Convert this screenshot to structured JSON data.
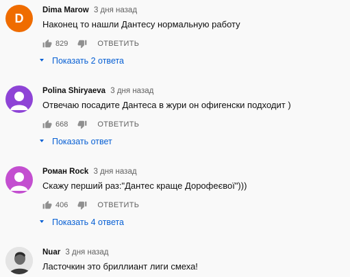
{
  "comments": [
    {
      "avatar_letter": "D",
      "avatar_color": "#ef6c00",
      "author": "Dima Marow",
      "time": "3 дня назад",
      "text": "Наконец то нашли Дантесу нормальную работу",
      "likes": "829",
      "reply_label": "ОТВЕТИТЬ",
      "replies_label": "Показать 2 ответа"
    },
    {
      "avatar_letter": "",
      "avatar_color": "#8e44d6",
      "author": "Polina Shiryaeva",
      "time": "3 дня назад",
      "text": "Отвечаю посадите Дантеса в жури он офигенски подходит )",
      "likes": "668",
      "reply_label": "ОТВЕТИТЬ",
      "replies_label": "Показать ответ"
    },
    {
      "avatar_letter": "",
      "avatar_color": "#c34fd0",
      "author": "Роман Rock",
      "time": "3 дня назад",
      "text": "Скажу перший раз:\"Дантес краще Дорофеєвої\")))",
      "likes": "406",
      "reply_label": "ОТВЕТИТЬ",
      "replies_label": "Показать 4 ответа"
    },
    {
      "avatar_letter": "",
      "avatar_color": "#d9d9d9",
      "author": "Nuar",
      "time": "3 дня назад",
      "text": "Ласточкин это бриллиант лиги смеха!"
    }
  ],
  "colors": {
    "link": "#065fd4",
    "muted": "#606060"
  }
}
